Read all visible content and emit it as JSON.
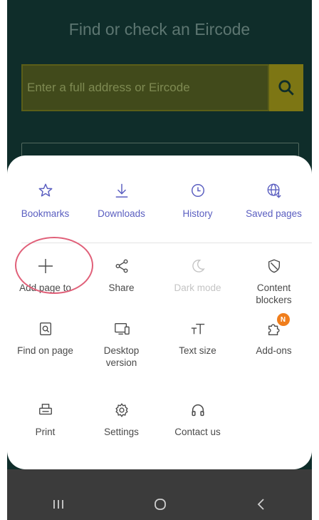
{
  "background_page": {
    "heading": "Find or check an Eircode",
    "search_placeholder": "Enter a full address or Eircode"
  },
  "menu": {
    "row1": [
      {
        "label": "Bookmarks",
        "icon": "star-icon"
      },
      {
        "label": "Downloads",
        "icon": "download-icon"
      },
      {
        "label": "History",
        "icon": "clock-icon"
      },
      {
        "label": "Saved pages",
        "icon": "globe-download-icon"
      }
    ],
    "row2": [
      {
        "label": "Add page to",
        "icon": "plus-icon"
      },
      {
        "label": "Share",
        "icon": "share-icon"
      },
      {
        "label": "Dark mode",
        "icon": "moon-icon",
        "disabled": true
      },
      {
        "label": "Content blockers",
        "icon": "shield-icon"
      }
    ],
    "row3": [
      {
        "label": "Find on page",
        "icon": "find-on-page-icon"
      },
      {
        "label": "Desktop version",
        "icon": "desktop-icon"
      },
      {
        "label": "Text size",
        "icon": "text-size-icon"
      },
      {
        "label": "Add-ons",
        "icon": "puzzle-icon",
        "badge": "N"
      }
    ],
    "row4": [
      {
        "label": "Print",
        "icon": "printer-icon"
      },
      {
        "label": "Settings",
        "icon": "gear-icon"
      },
      {
        "label": "Contact us",
        "icon": "headset-icon"
      }
    ]
  },
  "colors": {
    "accent": "#5a5ec0",
    "highlight": "#e06079",
    "badge": "#f07e1c"
  }
}
